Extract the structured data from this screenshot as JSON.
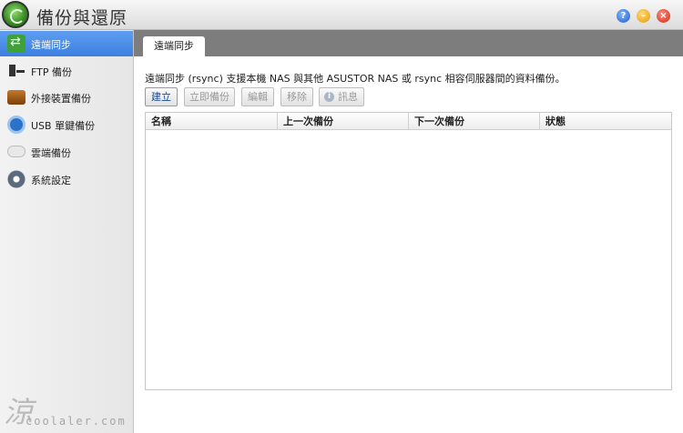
{
  "window": {
    "title": "備份與還原",
    "help_label": "?",
    "min_label": "–",
    "close_label": "×"
  },
  "sidebar": {
    "items": [
      {
        "label": "遠端同步",
        "icon": "remote-sync-icon",
        "active": true
      },
      {
        "label": "FTP 備份",
        "icon": "ftp-icon",
        "active": false
      },
      {
        "label": "外接裝置備份",
        "icon": "external-drive-icon",
        "active": false
      },
      {
        "label": "USB 單鍵備份",
        "icon": "usb-button-icon",
        "active": false
      },
      {
        "label": "雲端備份",
        "icon": "cloud-icon",
        "active": false
      },
      {
        "label": "系統設定",
        "icon": "gear-icon",
        "active": false
      }
    ]
  },
  "main": {
    "tab_label": "遠端同步",
    "description": "遠端同步 (rsync) 支援本機 NAS 與其他 ASUSTOR NAS 或 rsync 相容伺服器間的資料備份。",
    "toolbar": {
      "create": "建立",
      "backup_now": "立即備份",
      "edit": "編輯",
      "remove": "移除",
      "info": "訊息"
    },
    "table": {
      "columns": [
        "名稱",
        "上一次備份",
        "下一次備份",
        "狀態"
      ],
      "rows": []
    }
  },
  "watermark": {
    "logo": "涼",
    "text": "coolaler.com"
  },
  "colors": {
    "active_item": "#3c7fe0",
    "tabstrip": "#7d7d7d"
  }
}
